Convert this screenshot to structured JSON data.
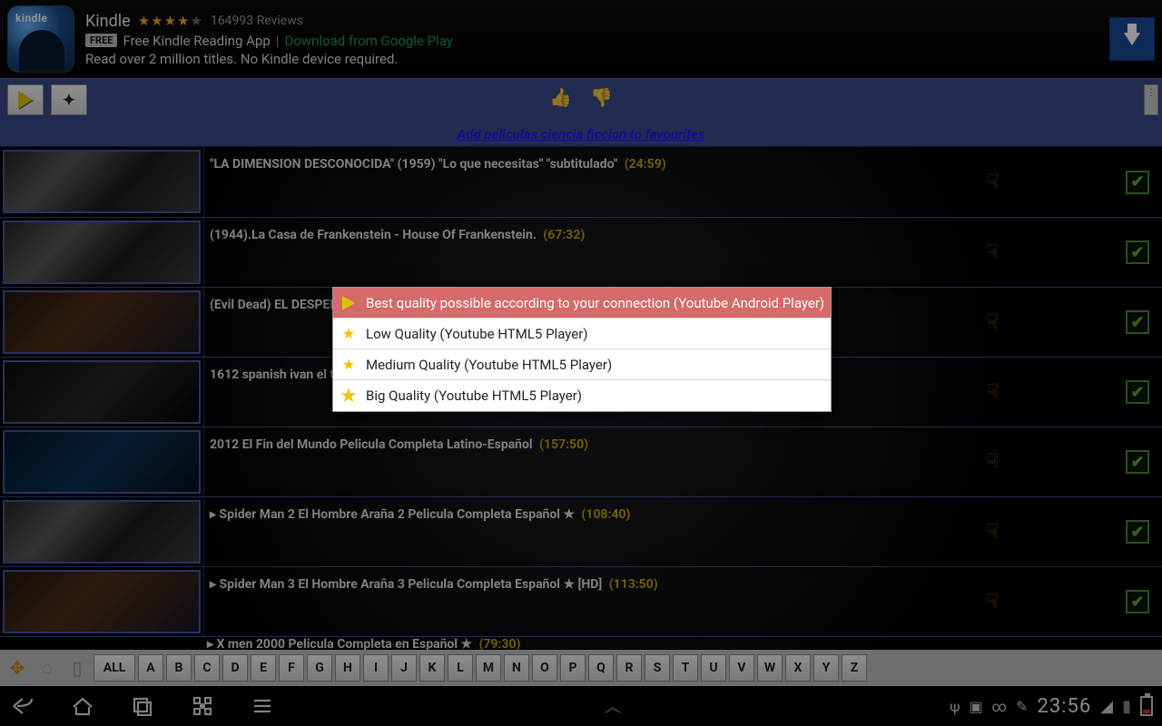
{
  "ad": {
    "title": "Kindle",
    "stars_full": "★★★★",
    "stars_dim": "★",
    "reviews": "164993 Reviews",
    "free": "FREE",
    "subtitle": "Free Kindle Reading App",
    "pipe": "|",
    "link": "Download from Google Play",
    "tagline": "Read over 2 million titles. No Kindle device required."
  },
  "toolbar": {
    "fav_link": "Add peliculas ciencia ficcion to favourites",
    "thumb_up": "👍",
    "thumb_down": "👎"
  },
  "videos": [
    {
      "title": "\"LA DIMENSION DESCONOCIDA\" (1959) \"Lo que necesitas\" \"subtitulado\"",
      "dur": "(24:59)",
      "pre": "",
      "thumb": "bw"
    },
    {
      "title": "(1944).La Casa de Frankenstein - House Of Frankenstein.",
      "dur": "(67:32)",
      "pre": "",
      "thumb": "bw"
    },
    {
      "title": "(Evil Dead) EL DESPERT",
      "dur": "",
      "pre": "",
      "thumb": "color"
    },
    {
      "title": "1612 spanish ivan el ter",
      "dur": "",
      "pre": "",
      "thumb": "dark"
    },
    {
      "title": "2012 El Fin del Mundo Pelicula Completa Latino-Español",
      "dur": "(157:50)",
      "pre": "",
      "thumb": "blue"
    },
    {
      "title": "Spider Man 2 El Hombre Araña 2 Pelicula Completa Español ★",
      "dur": "(108:40)",
      "pre": "▸ ",
      "thumb": "bw"
    },
    {
      "title": "Spider Man 3 El Hombre Araña 3 Pelicula Completa Español ★ [HD]",
      "dur": "(113:50)",
      "pre": "▸ ",
      "thumb": "color"
    }
  ],
  "partial_row": {
    "pre": "▸ ",
    "title": "X men 2000 Pelicula Completa en Español ★",
    "dur": "(79:30)"
  },
  "popup": {
    "o0": "Best quality possible according to your connection (Youtube Android Player)",
    "o1": "Low Quality (Youtube HTML5 Player)",
    "o2": "Medium Quality (Youtube HTML5 Player)",
    "o3": "Big Quality (Youtube HTML5 Player)"
  },
  "az": {
    "all": "ALL",
    "letters": [
      "A",
      "B",
      "C",
      "D",
      "E",
      "F",
      "G",
      "H",
      "I",
      "J",
      "K",
      "L",
      "M",
      "N",
      "O",
      "P",
      "Q",
      "R",
      "S",
      "T",
      "U",
      "V",
      "W",
      "X",
      "Y",
      "Z"
    ]
  },
  "status": {
    "clock": "23:56",
    "usb": "ψ",
    "pic": "▣",
    "vm": "⚇",
    "pen": "✎"
  }
}
